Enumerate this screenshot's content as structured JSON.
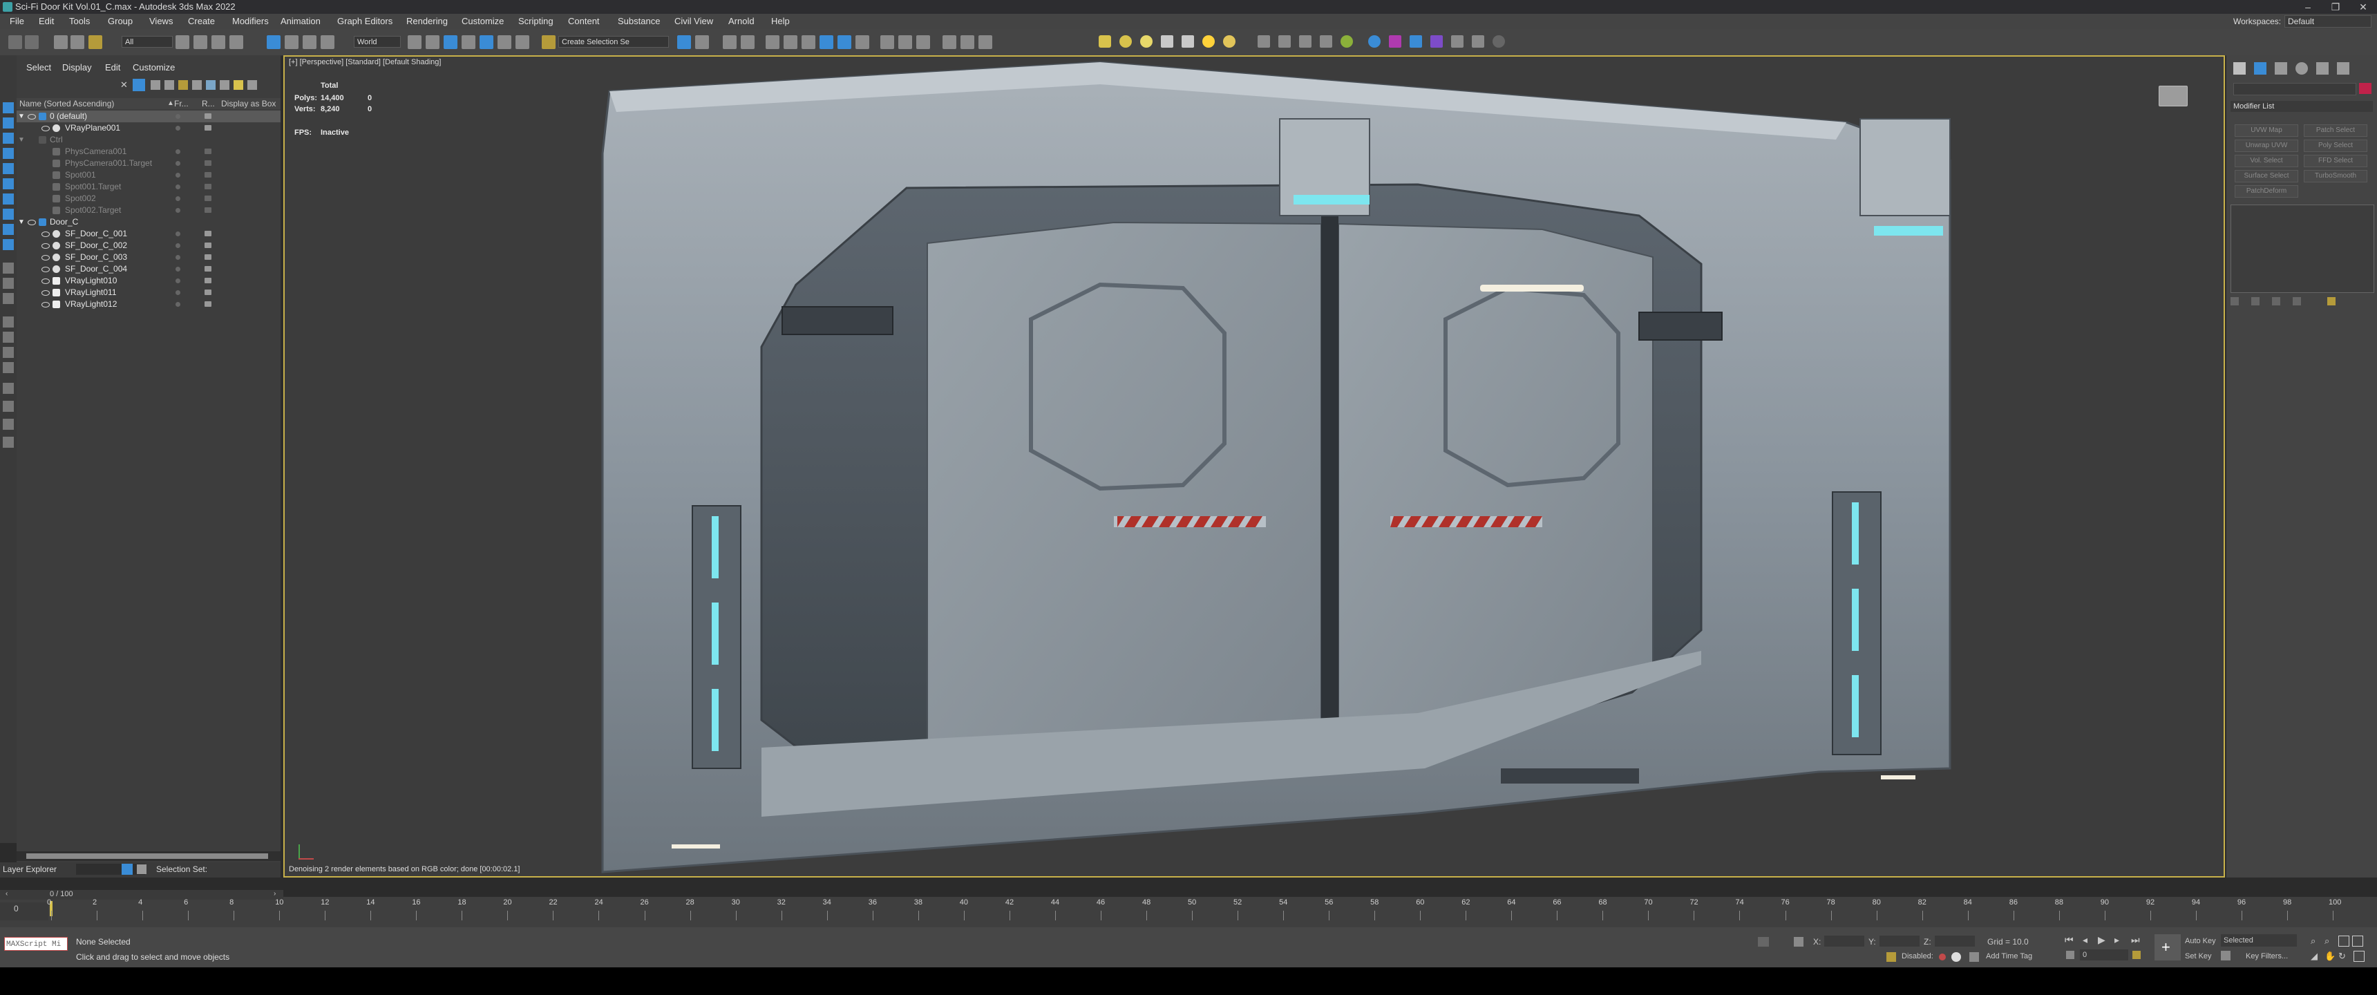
{
  "window": {
    "title": "Sci-Fi Door Kit Vol.01_C.max - Autodesk 3ds Max 2022"
  },
  "menu": [
    "File",
    "Edit",
    "Tools",
    "Group",
    "Views",
    "Create",
    "Modifiers",
    "Animation",
    "Graph Editors",
    "Rendering",
    "Customize",
    "Scripting",
    "Content",
    "Substance",
    "Civil View",
    "Arnold",
    "Help"
  ],
  "workspace": {
    "label": "Workspaces:",
    "value": "Default"
  },
  "toolbar": {
    "filter_value": "All",
    "coord_value": "World",
    "selection_set_placeholder": "Create Selection Se"
  },
  "scene_explorer": {
    "tabs": [
      "Select",
      "Display",
      "Edit",
      "Customize"
    ],
    "columns": {
      "name": "Name (Sorted Ascending)",
      "fr": "Fr...",
      "r": "R...",
      "display": "Display as Box"
    },
    "rows": [
      {
        "label": "0 (default)",
        "dim": false,
        "indent": 0
      },
      {
        "label": "VRayPlane001",
        "dim": false,
        "indent": 1
      },
      {
        "label": "Ctrl",
        "dim": true,
        "indent": 0
      },
      {
        "label": "PhysCamera001",
        "dim": true,
        "indent": 1
      },
      {
        "label": "PhysCamera001.Target",
        "dim": true,
        "indent": 1
      },
      {
        "label": "Spot001",
        "dim": true,
        "indent": 1
      },
      {
        "label": "Spot001.Target",
        "dim": true,
        "indent": 1
      },
      {
        "label": "Spot002",
        "dim": true,
        "indent": 1
      },
      {
        "label": "Spot002.Target",
        "dim": true,
        "indent": 1
      },
      {
        "label": "Door_C",
        "dim": false,
        "indent": 0
      },
      {
        "label": "SF_Door_C_001",
        "dim": false,
        "indent": 1
      },
      {
        "label": "SF_Door_C_002",
        "dim": false,
        "indent": 1
      },
      {
        "label": "SF_Door_C_003",
        "dim": false,
        "indent": 1
      },
      {
        "label": "SF_Door_C_004",
        "dim": false,
        "indent": 1
      },
      {
        "label": "VRayLight010",
        "dim": false,
        "indent": 1
      },
      {
        "label": "VRayLight011",
        "dim": false,
        "indent": 1
      },
      {
        "label": "VRayLight012",
        "dim": false,
        "indent": 1
      }
    ],
    "footer": {
      "layer_explorer": "Layer Explorer",
      "selection_set": "Selection Set:"
    }
  },
  "viewport": {
    "label": "[+] [Perspective] [Standard] [Default Shading]",
    "stats": {
      "total": "Total",
      "polys_label": "Polys:",
      "polys_value": "14,400",
      "polys_sel": "0",
      "verts_label": "Verts:",
      "verts_value": "8,240",
      "verts_sel": "0",
      "fps_label": "FPS:",
      "fps_value": "Inactive"
    },
    "message": "Denoising 2 render elements based on RGB color; done [00:00:02.1]"
  },
  "command_panel": {
    "modifier_list": "Modifier List",
    "buttons": [
      "UVW Map",
      "Patch Select",
      "Unwrap UVW",
      "Poly Select",
      "Vol. Select",
      "FFD Select",
      "Surface Select",
      "TurboSmooth",
      "PatchDeform"
    ]
  },
  "timeline": {
    "frame": "0 / 100",
    "ticks": [
      "0",
      "2",
      "4",
      "6",
      "8",
      "10",
      "12",
      "14",
      "16",
      "18",
      "20",
      "22",
      "24",
      "26",
      "28",
      "30",
      "32",
      "34",
      "36",
      "38",
      "40",
      "42",
      "44",
      "46",
      "48",
      "50",
      "52",
      "54",
      "56",
      "58",
      "60",
      "62",
      "64",
      "66",
      "68",
      "70",
      "72",
      "74",
      "76",
      "78",
      "80",
      "82",
      "84",
      "86",
      "88",
      "90",
      "92",
      "94",
      "96",
      "98",
      "100"
    ]
  },
  "status": {
    "maxscript": "MAXScript Mi",
    "selection": "None Selected",
    "prompt": "Click and drag to select and move objects",
    "x_label": "X:",
    "y_label": "Y:",
    "z_label": "Z:",
    "grid": "Grid = 10.0",
    "disabled": "Disabled:",
    "add_time_tag": "Add Time Tag",
    "auto_key": "Auto Key",
    "selected": "Selected",
    "set_key": "Set Key",
    "key_filters": "Key Filters...",
    "frame_value": "0"
  },
  "colors": {
    "accent_active": "#3a8cd6",
    "viewport_border": "#c8b14a",
    "door_light": "#7de6ef"
  }
}
